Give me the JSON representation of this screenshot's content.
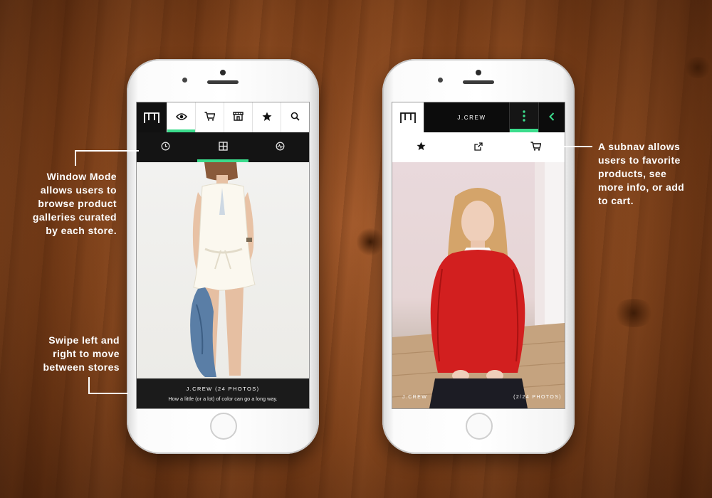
{
  "left_phone": {
    "top_nav": {
      "logo_icon": "storefront-logo-icon",
      "items": [
        {
          "icon": "eye-icon",
          "active": true
        },
        {
          "icon": "cart-icon",
          "active": false
        },
        {
          "icon": "store-icon",
          "active": false
        },
        {
          "icon": "star-icon",
          "active": false
        },
        {
          "icon": "search-icon",
          "active": false
        }
      ]
    },
    "sub_nav": {
      "items": [
        {
          "icon": "clock-icon",
          "active": false
        },
        {
          "icon": "grid-window-icon",
          "active": true
        },
        {
          "icon": "activity-icon",
          "active": false
        }
      ]
    },
    "caption": {
      "store": "J.CREW",
      "count": "(24 PHOTOS)",
      "text": "How a little (or a lot) of color can go a long way."
    }
  },
  "right_phone": {
    "top_nav": {
      "logo_icon": "storefront-logo-icon",
      "store_title": "J.CREW",
      "more_icon": "vertical-dots-icon",
      "back_icon": "chevron-left-icon"
    },
    "sub_nav": {
      "items": [
        {
          "icon": "star-icon"
        },
        {
          "icon": "external-link-icon"
        },
        {
          "icon": "cart-icon"
        }
      ]
    },
    "photo_overlay": {
      "store": "J.CREW",
      "counter": "(2/24 PHOTOS)"
    }
  },
  "annotations": {
    "window_mode": "Window Mode allows users to browse product galleries curated by each store.",
    "window_mode_lines": [
      "Window Mode",
      "allows users to",
      "browse product",
      "galleries curated",
      "by each store."
    ],
    "swipe_lines": [
      "Swipe left and",
      "right to move",
      "between stores"
    ],
    "subnav_lines": [
      "A subnav allows",
      "users to favorite",
      "products, see",
      "more info, or add",
      "to cart."
    ]
  },
  "colors": {
    "accent": "#3bdc8c",
    "dark_bar": "#141414",
    "sweater": "#d21f1f"
  }
}
